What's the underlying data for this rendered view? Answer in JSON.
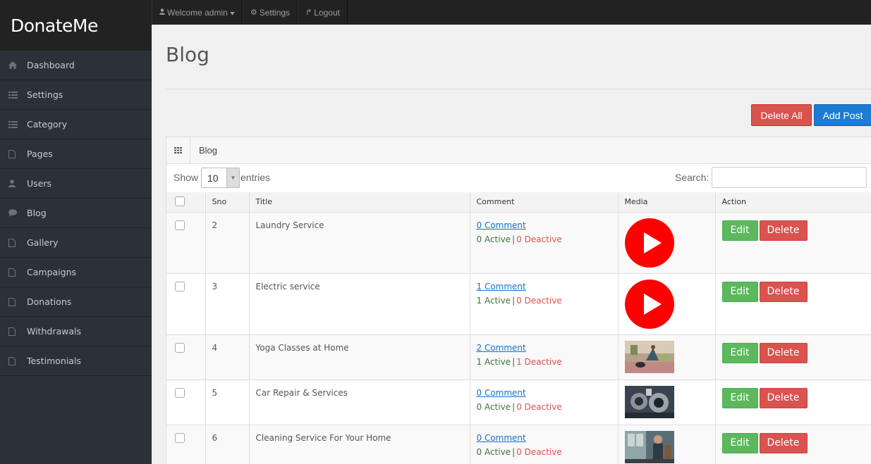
{
  "brand": "DonateMe",
  "sidebar": {
    "items": [
      {
        "label": "Dashboard",
        "icon": "home-icon"
      },
      {
        "label": "Settings",
        "icon": "list-icon"
      },
      {
        "label": "Category",
        "icon": "list-icon"
      },
      {
        "label": "Pages",
        "icon": "file-icon"
      },
      {
        "label": "Users",
        "icon": "user-icon"
      },
      {
        "label": "Blog",
        "icon": "comment-icon"
      },
      {
        "label": "Gallery",
        "icon": "file-icon"
      },
      {
        "label": "Campaigns",
        "icon": "file-icon"
      },
      {
        "label": "Donations",
        "icon": "file-icon"
      },
      {
        "label": "Withdrawals",
        "icon": "file-icon"
      },
      {
        "label": "Testimonials",
        "icon": "file-icon"
      }
    ]
  },
  "topbar": {
    "welcome": "Welcome admin",
    "settings": "Settings",
    "logout": "Logout"
  },
  "page": {
    "title": "Blog",
    "delete_all": "Delete All",
    "add_post": "Add Post"
  },
  "panel": {
    "title": "Blog",
    "show_label": "Show",
    "page_length": "10",
    "entries_label": "entries",
    "search_label": "Search:",
    "search_value": ""
  },
  "table": {
    "columns": [
      "Sno",
      "Title",
      "Comment",
      "Media",
      "Action"
    ],
    "edit_label": "Edit",
    "delete_label": "Delete",
    "rows": [
      {
        "sno": "2",
        "title": "Laundry Service",
        "comment": "0 Comment",
        "active": "0 Active",
        "deactive": "0 Deactive",
        "media": "youtube-play-icon"
      },
      {
        "sno": "3",
        "title": "Electric service",
        "comment": "1 Comment",
        "active": "1 Active",
        "deactive": "0 Deactive",
        "media": "youtube-play-icon"
      },
      {
        "sno": "4",
        "title": "Yoga Classes at Home",
        "comment": "2 Comment",
        "active": "1 Active",
        "deactive": "1 Deactive",
        "media": "yoga-photo"
      },
      {
        "sno": "5",
        "title": "Car Repair & Services",
        "comment": "0 Comment",
        "active": "0 Active",
        "deactive": "0 Deactive",
        "media": "car-engine-photo"
      },
      {
        "sno": "6",
        "title": "Cleaning Service For Your Home",
        "comment": "0 Comment",
        "active": "0 Active",
        "deactive": "0 Deactive",
        "media": "cleaning-photo"
      }
    ]
  },
  "colors": {
    "sidebar_bg": "#2b3139",
    "topbar_bg": "#222222",
    "danger": "#d9534f",
    "primary": "#1c7bd3",
    "success": "#5cb85c",
    "link": "#1a6fc9"
  }
}
